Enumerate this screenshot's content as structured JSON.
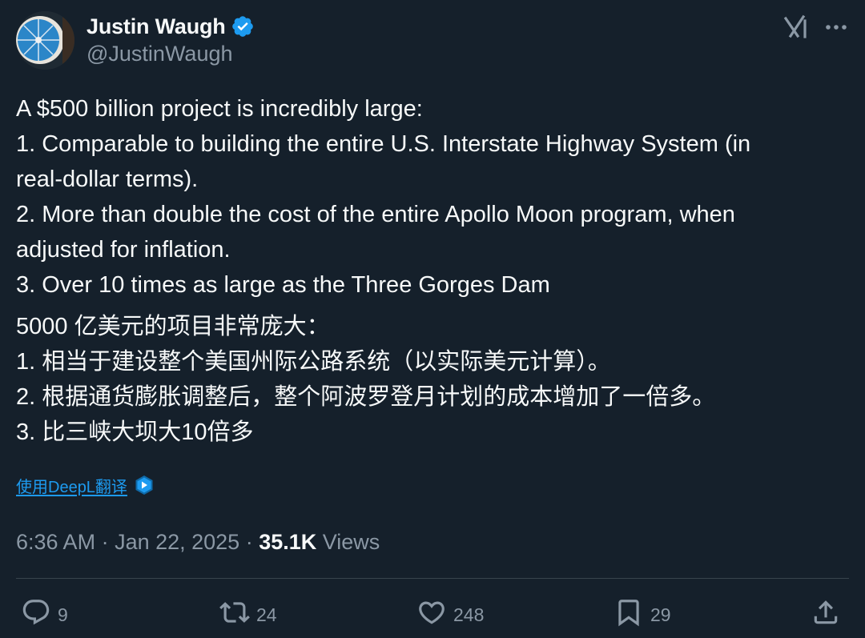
{
  "author": {
    "display_name": "Justin Waugh",
    "handle": "@JustinWaugh",
    "verified": true
  },
  "tweet": {
    "lines_en": [
      "A $500 billion project is incredibly large:",
      "1. Comparable to building the entire U.S. Interstate Highway System (in",
      "real-dollar terms).",
      "2. More than double the cost of the entire Apollo Moon program, when",
      "adjusted for inflation.",
      "3. Over 10 times as large as the Three Gorges Dam"
    ],
    "lines_zh": [
      "5000 亿美元的项目非常庞大：",
      "1. 相当于建设整个美国州际公路系统（以实际美元计算）。",
      "2. 根据通货膨胀调整后，整个阿波罗登月计划的成本增加了一倍多。",
      "3. 比三峡大坝大10倍多"
    ]
  },
  "translate": {
    "label": "使用DeepL翻译",
    "icon": "deepl-icon"
  },
  "meta": {
    "time": "6:36 AM",
    "separator": " · ",
    "date": "Jan 22, 2025",
    "views_count": "35.1K",
    "views_label": " Views"
  },
  "actions": {
    "replies": "9",
    "reposts": "24",
    "likes": "248",
    "bookmarks": "29"
  },
  "icons": {
    "reply": "reply-icon",
    "repost": "repost-icon",
    "like": "like-icon",
    "bookmark": "bookmark-icon",
    "share": "share-icon",
    "grok": "grok-icon",
    "more": "more-icon",
    "verified": "verified-badge-icon"
  },
  "colors": {
    "background": "#15202b",
    "text": "#f7f9f9",
    "secondary": "#8b98a5",
    "accent": "#1d9bf0",
    "divider": "#38444d"
  }
}
